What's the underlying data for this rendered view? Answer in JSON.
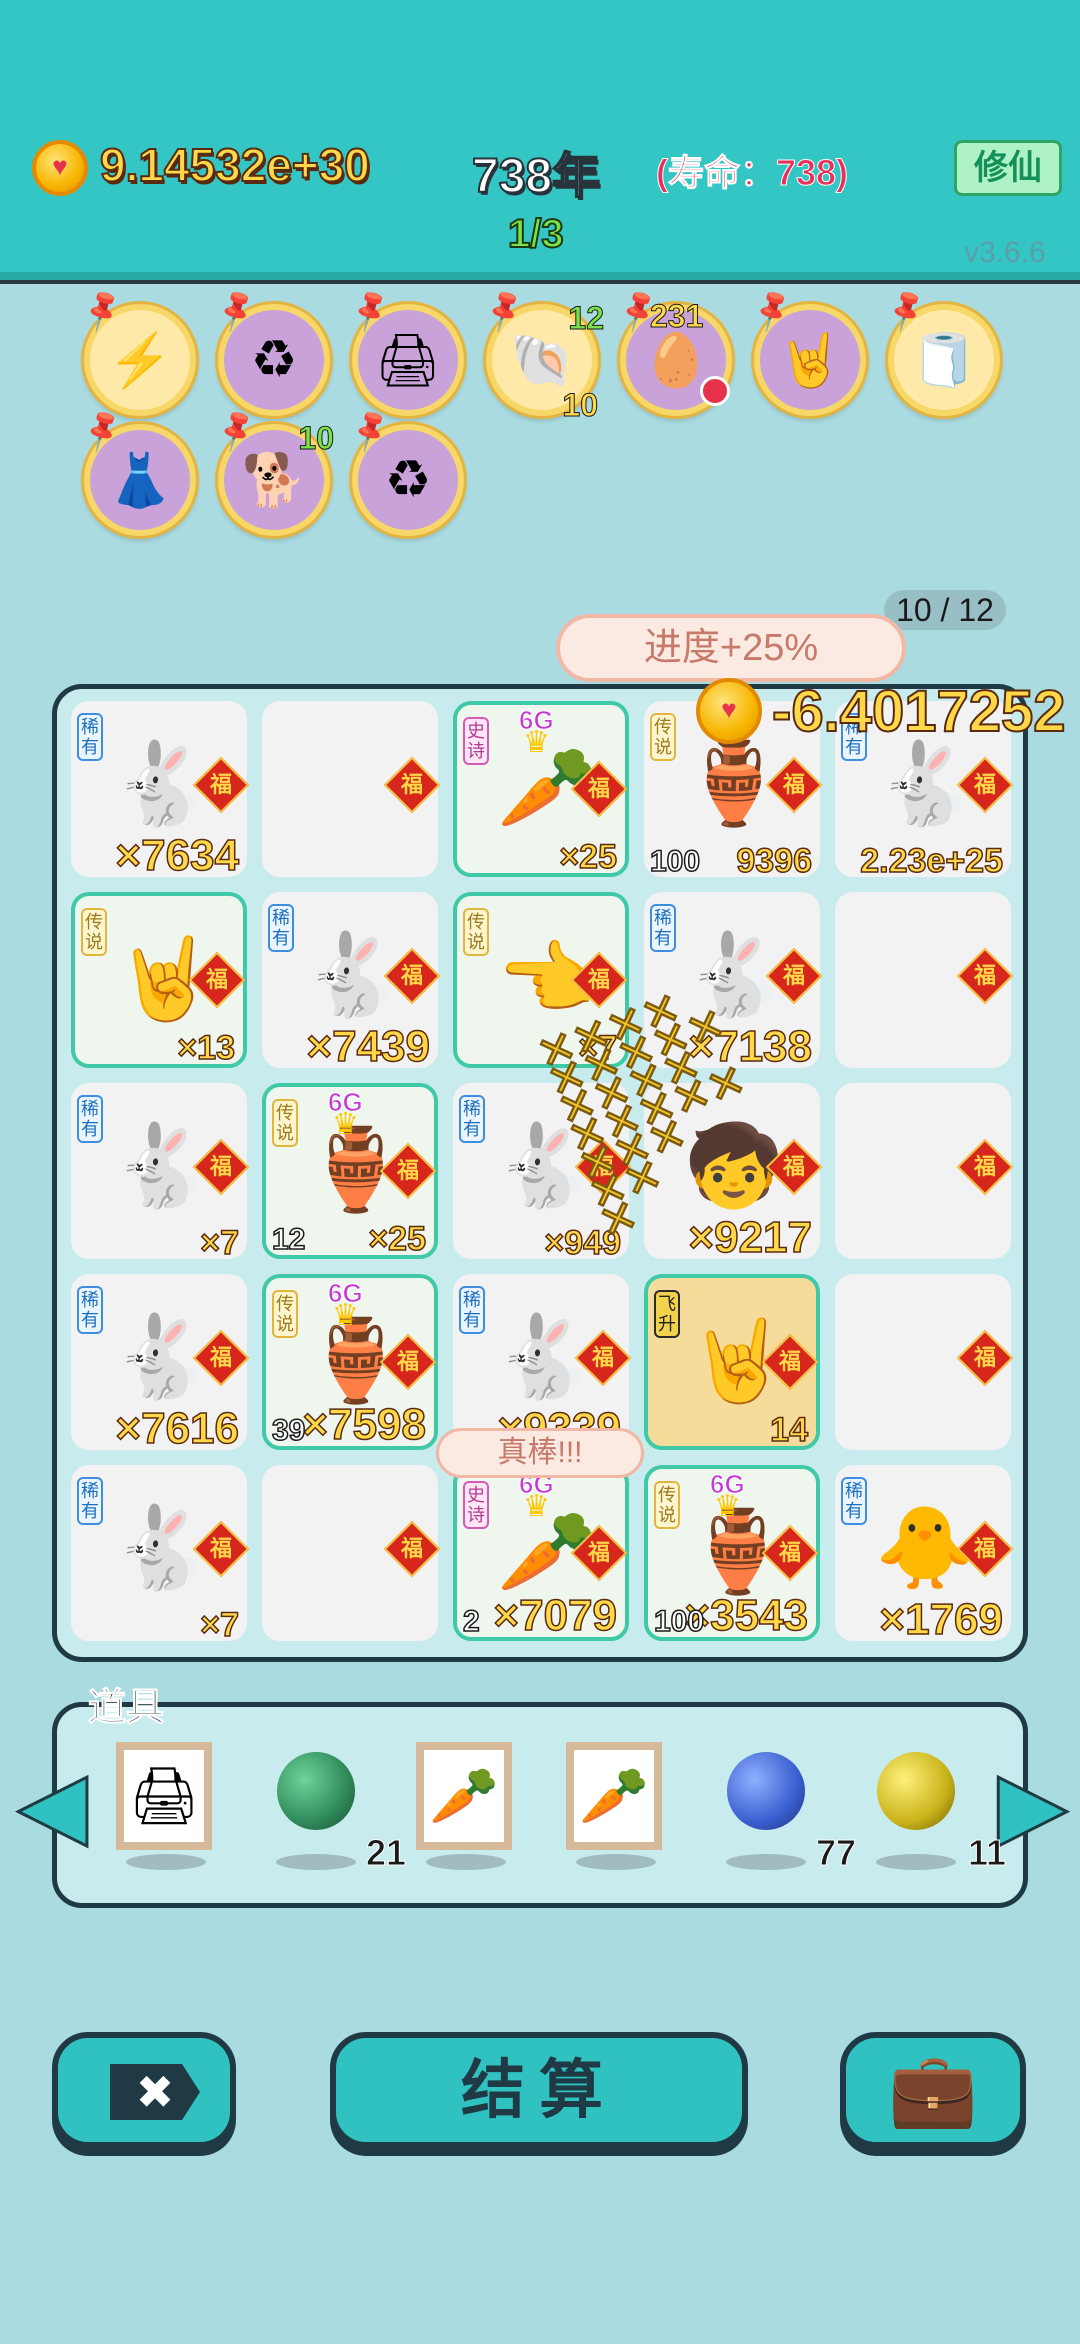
{
  "header": {
    "coin_amount": "9.14532e+30",
    "year": "738年",
    "lifespan": "(寿命：738)",
    "xiuxian_label": "修仙",
    "round": "1/3",
    "version": "v3.6.6"
  },
  "skills": [
    {
      "icon": "lightning-icon",
      "glyph": "⚡",
      "count": ""
    },
    {
      "icon": "recycle-icon",
      "glyph": "♻",
      "count": ""
    },
    {
      "icon": "printer-icon",
      "glyph": "🖨",
      "count": ""
    },
    {
      "icon": "shell-icon",
      "glyph": "🐚",
      "count_top": "12",
      "count_bottom": "10"
    },
    {
      "icon": "egg-tray-icon",
      "glyph": "🥚",
      "count_top": "231"
    },
    {
      "icon": "rock-hand-icon",
      "glyph": "🤘",
      "count": ""
    },
    {
      "icon": "tissue-box-icon",
      "glyph": "🧻",
      "count": ""
    },
    {
      "icon": "skirt-icon",
      "glyph": "👗",
      "count": ""
    },
    {
      "icon": "dog-icon",
      "glyph": "🐕",
      "count_top": "10"
    },
    {
      "icon": "recycle-icon",
      "glyph": "♻",
      "count": ""
    }
  ],
  "progress": {
    "label": "10 / 12",
    "banner": "进度+25%"
  },
  "float_reward": "-6.4017252",
  "praise": "真棒!!!",
  "board": {
    "fu": "福",
    "cells": [
      {
        "tag": "稀有",
        "icon": "rabbit-icon",
        "glyph": "🐇",
        "mult": "×7634",
        "lvl": ""
      },
      {
        "tag": "",
        "icon": "",
        "glyph": "",
        "mult": "",
        "lvl": ""
      },
      {
        "tag": "史诗",
        "icon": "carrot-icon",
        "glyph": "🥕",
        "mult": "×25",
        "lvl": "",
        "g6": "6G"
      },
      {
        "tag": "传说",
        "icon": "vase-icon",
        "glyph": "🏺",
        "mult": "9396",
        "lvl": "100"
      },
      {
        "tag": "稀有",
        "icon": "rabbit-icon",
        "glyph": "🐇",
        "mult": "2.23e+25",
        "lvl": ""
      },
      {
        "tag": "传说",
        "icon": "rock-hand-icon",
        "glyph": "🤘",
        "mult": "×13",
        "lvl": ""
      },
      {
        "tag": "稀有",
        "icon": "rabbit-icon",
        "glyph": "🐇",
        "mult": "×7439",
        "lvl": ""
      },
      {
        "tag": "传说",
        "icon": "pointing-hand-icon",
        "glyph": "👈",
        "mult": "×7",
        "lvl": ""
      },
      {
        "tag": "稀有",
        "icon": "rabbit-icon",
        "glyph": "🐇",
        "mult": "×7138",
        "lvl": ""
      },
      {
        "tag": "",
        "icon": "",
        "glyph": "",
        "mult": "",
        "lvl": ""
      },
      {
        "tag": "稀有",
        "icon": "rabbit-icon",
        "glyph": "🐇",
        "mult": "×7",
        "lvl": ""
      },
      {
        "tag": "传说",
        "icon": "vase-icon",
        "glyph": "🏺",
        "mult": "×25",
        "lvl": "12",
        "g6": "6G"
      },
      {
        "tag": "稀有",
        "icon": "rabbit-icon",
        "glyph": "🐇",
        "mult": "×949",
        "lvl": ""
      },
      {
        "tag": "",
        "icon": "baby-face-icon",
        "glyph": "🧒",
        "mult": "×9217",
        "lvl": ""
      },
      {
        "tag": "",
        "icon": "",
        "glyph": "",
        "mult": "",
        "lvl": ""
      },
      {
        "tag": "稀有",
        "icon": "rabbit-icon",
        "glyph": "🐇",
        "mult": "×7616",
        "lvl": ""
      },
      {
        "tag": "传说",
        "icon": "vase-icon",
        "glyph": "🏺",
        "mult": "×7598",
        "lvl": "39",
        "g6": "6G"
      },
      {
        "tag": "稀有",
        "icon": "rabbit-icon",
        "glyph": "🐇",
        "mult": "×9339",
        "lvl": ""
      },
      {
        "tag": "飞升",
        "icon": "rock-hand-icon",
        "glyph": "🤘",
        "mult": "14",
        "lvl": ""
      },
      {
        "tag": "",
        "icon": "",
        "glyph": "",
        "mult": "",
        "lvl": ""
      },
      {
        "tag": "稀有",
        "icon": "rabbit-icon",
        "glyph": "🐇",
        "mult": "×7",
        "lvl": ""
      },
      {
        "tag": "",
        "icon": "",
        "glyph": "",
        "mult": "",
        "lvl": ""
      },
      {
        "tag": "史诗",
        "icon": "carrot-icon",
        "glyph": "🥕",
        "mult": "×7079",
        "lvl": "2",
        "g6": "6G"
      },
      {
        "tag": "传说",
        "icon": "vase-icon",
        "glyph": "🏺",
        "mult": "×3543",
        "lvl": "100",
        "g6": "6G"
      },
      {
        "tag": "稀有",
        "icon": "chick-icon",
        "glyph": "🐥",
        "mult": "×1769",
        "lvl": ""
      }
    ]
  },
  "props": {
    "title": "道具",
    "items": [
      {
        "icon": "printer-card-icon",
        "glyph": "🖨",
        "count": ""
      },
      {
        "icon": "green-ball-icon",
        "color": "#2f8a5a",
        "count": "21"
      },
      {
        "icon": "carrot-card-icon",
        "glyph": "🥕",
        "count": ""
      },
      {
        "icon": "carrot-card-icon",
        "glyph": "🥕",
        "count": ""
      },
      {
        "icon": "blue-ball-icon",
        "color": "#3a5fd0",
        "count": "77"
      },
      {
        "icon": "yellow-ball-icon",
        "color": "#c9b21a",
        "count": "11"
      }
    ]
  },
  "buttons": {
    "close": "✖",
    "settle": "结算",
    "bag": "💼"
  },
  "colors": {
    "header": "#33c6c4",
    "background": "#a9dbe0",
    "coin_text": "#ffd84a",
    "board_border": "#1f3a45"
  }
}
